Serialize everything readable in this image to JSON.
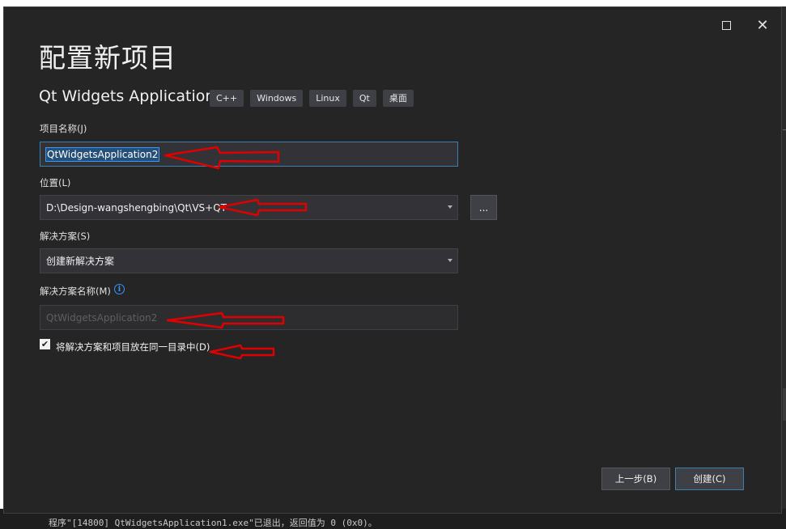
{
  "dialog": {
    "title": "配置新项目",
    "template_name": "Qt Widgets Application",
    "tags": [
      "C++",
      "Windows",
      "Linux",
      "Qt",
      "桌面"
    ]
  },
  "fields": {
    "project_name": {
      "label": "项目名称(J)",
      "value": "QtWidgetsApplication2"
    },
    "location": {
      "label": "位置(L)",
      "value": "D:\\Design-wangshengbing\\Qt\\VS+QT",
      "browse_label": "..."
    },
    "solution": {
      "label": "解决方案(S)",
      "value": "创建新解决方案"
    },
    "solution_name": {
      "label": "解决方案名称(M)",
      "value": "QtWidgetsApplication2"
    },
    "same_directory": {
      "label": "将解决方案和项目放在同一目录中(D)",
      "checked": true
    }
  },
  "buttons": {
    "back": "上一步(B)",
    "create": "创建(C)"
  },
  "window_controls": {
    "maximize": "maximize-icon",
    "close": "close-icon"
  },
  "background": {
    "output_text": "程序\"[14800] QtWidgetsApplication1.exe\"已退出，返回值为 0 (0x0)。"
  },
  "colors": {
    "annotation_arrow": "#e00000",
    "accent": "#3c7fb1"
  }
}
